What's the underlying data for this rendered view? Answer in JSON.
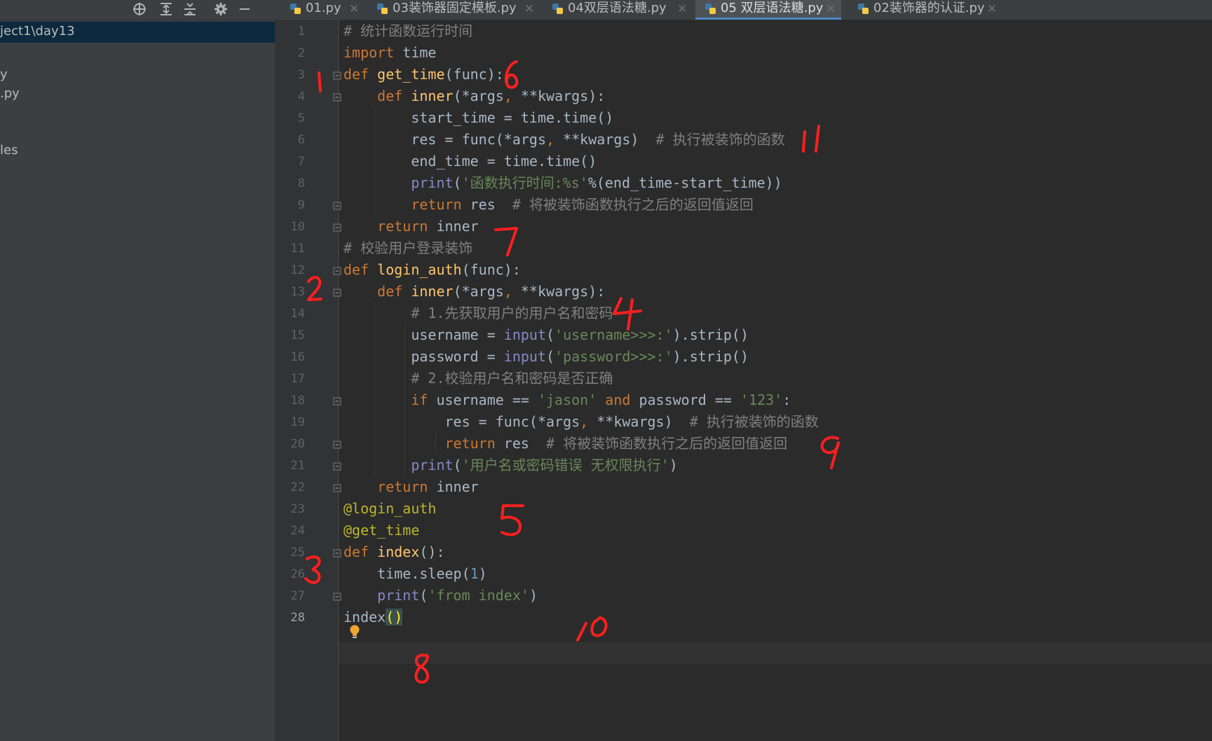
{
  "sidebar": {
    "path": "ject1\\day13",
    "items": [
      "y",
      ".py",
      "les"
    ]
  },
  "tabs": [
    {
      "label": "01.py",
      "active": false
    },
    {
      "label": "03装饰器固定模板.py",
      "active": false
    },
    {
      "label": "04双层语法糖.py",
      "active": false
    },
    {
      "label": "05 双层语法糖.py",
      "active": true
    },
    {
      "label": "02装饰器的认证.py",
      "active": false
    }
  ],
  "toolbar": {
    "icons": [
      "locate-icon",
      "expand-all-icon",
      "collapse-all-icon",
      "gear-icon",
      "minimize-icon"
    ]
  },
  "editor": {
    "current_line": 28,
    "lines": [
      {
        "n": "1",
        "tokens": [
          [
            "cmt",
            "# 统计函数运行时间"
          ]
        ]
      },
      {
        "n": "2",
        "tokens": [
          [
            "kw",
            "import"
          ],
          [
            "",
            " time"
          ]
        ]
      },
      {
        "n": "3",
        "tokens": [
          [
            "kw",
            "def "
          ],
          [
            "fn",
            "get_time"
          ],
          [
            "",
            "(func):"
          ]
        ]
      },
      {
        "n": "4",
        "tokens": [
          [
            "",
            "    "
          ],
          [
            "kw",
            "def "
          ],
          [
            "fn",
            "inner"
          ],
          [
            "",
            "(*args"
          ],
          [
            "kw",
            ", "
          ],
          [
            "",
            "**kwargs):"
          ]
        ]
      },
      {
        "n": "5",
        "tokens": [
          [
            "",
            "        start_time = time.time()"
          ]
        ]
      },
      {
        "n": "6",
        "tokens": [
          [
            "",
            "        res = func(*args"
          ],
          [
            "kw",
            ", "
          ],
          [
            "",
            "**kwargs)  "
          ],
          [
            "cmt",
            "# 执行被装饰的函数"
          ]
        ]
      },
      {
        "n": "7",
        "tokens": [
          [
            "",
            "        end_time = time.time()"
          ]
        ]
      },
      {
        "n": "8",
        "tokens": [
          [
            "",
            "        "
          ],
          [
            "bi",
            "print"
          ],
          [
            "",
            "("
          ],
          [
            "str",
            "'函数执行时间:%s'"
          ],
          [
            "",
            "%(end_time-start_time))"
          ]
        ]
      },
      {
        "n": "9",
        "tokens": [
          [
            "",
            "        "
          ],
          [
            "kw",
            "return"
          ],
          [
            "",
            " res  "
          ],
          [
            "cmt",
            "# 将被装饰函数执行之后的返回值返回"
          ]
        ]
      },
      {
        "n": "10",
        "tokens": [
          [
            "",
            "    "
          ],
          [
            "kw",
            "return"
          ],
          [
            "",
            " inner"
          ]
        ]
      },
      {
        "n": "11",
        "tokens": [
          [
            "cmt",
            "# 校验用户登录装饰"
          ]
        ]
      },
      {
        "n": "12",
        "tokens": [
          [
            "kw",
            "def "
          ],
          [
            "fn",
            "login_auth"
          ],
          [
            "",
            "(func):"
          ]
        ]
      },
      {
        "n": "13",
        "tokens": [
          [
            "",
            "    "
          ],
          [
            "kw",
            "def "
          ],
          [
            "fn",
            "inner"
          ],
          [
            "",
            "(*args"
          ],
          [
            "kw",
            ", "
          ],
          [
            "",
            "**kwargs):"
          ]
        ]
      },
      {
        "n": "14",
        "tokens": [
          [
            "",
            "        "
          ],
          [
            "cmt",
            "# 1.先获取用户的用户名和密码"
          ]
        ]
      },
      {
        "n": "15",
        "tokens": [
          [
            "",
            "        username = "
          ],
          [
            "bi",
            "input"
          ],
          [
            "",
            "("
          ],
          [
            "str",
            "'username>>>:'"
          ],
          [
            "",
            ").strip()"
          ]
        ]
      },
      {
        "n": "16",
        "tokens": [
          [
            "",
            "        password = "
          ],
          [
            "bi",
            "input"
          ],
          [
            "",
            "("
          ],
          [
            "str",
            "'password>>>:'"
          ],
          [
            "",
            ").strip()"
          ]
        ]
      },
      {
        "n": "17",
        "tokens": [
          [
            "",
            "        "
          ],
          [
            "cmt",
            "# 2.校验用户名和密码是否正确"
          ]
        ]
      },
      {
        "n": "18",
        "tokens": [
          [
            "",
            "        "
          ],
          [
            "kw",
            "if"
          ],
          [
            "",
            " username == "
          ],
          [
            "str",
            "'jason'"
          ],
          [
            "kw",
            " and"
          ],
          [
            "",
            " password == "
          ],
          [
            "str",
            "'123'"
          ],
          [
            "",
            ":"
          ]
        ]
      },
      {
        "n": "19",
        "tokens": [
          [
            "",
            "            res = func(*args"
          ],
          [
            "kw",
            ", "
          ],
          [
            "",
            "**kwargs)  "
          ],
          [
            "cmt",
            "# 执行被装饰的函数"
          ]
        ]
      },
      {
        "n": "20",
        "tokens": [
          [
            "",
            "            "
          ],
          [
            "kw",
            "return"
          ],
          [
            "",
            " res  "
          ],
          [
            "cmt",
            "# 将被装饰函数执行之后的返回值返回"
          ]
        ]
      },
      {
        "n": "21",
        "tokens": [
          [
            "",
            "        "
          ],
          [
            "bi",
            "print"
          ],
          [
            "",
            "("
          ],
          [
            "str",
            "'用户名或密码错误 无权限执行'"
          ],
          [
            "",
            ")"
          ]
        ]
      },
      {
        "n": "22",
        "tokens": [
          [
            "",
            "    "
          ],
          [
            "kw",
            "return"
          ],
          [
            "",
            " inner"
          ]
        ]
      },
      {
        "n": "23",
        "tokens": [
          [
            "dec",
            "@login_auth"
          ]
        ]
      },
      {
        "n": "24",
        "tokens": [
          [
            "dec",
            "@get_time"
          ]
        ]
      },
      {
        "n": "25",
        "tokens": [
          [
            "kw",
            "def "
          ],
          [
            "fn",
            "index"
          ],
          [
            "",
            "():"
          ]
        ]
      },
      {
        "n": "26",
        "tokens": [
          [
            "",
            "    time.sleep("
          ],
          [
            "num",
            "1"
          ],
          [
            "",
            ")"
          ]
        ]
      },
      {
        "n": "27",
        "tokens": [
          [
            "",
            "    "
          ],
          [
            "bi",
            "print"
          ],
          [
            "",
            "("
          ],
          [
            "str",
            "'from index'"
          ],
          [
            "",
            ")"
          ]
        ]
      },
      {
        "n": "28",
        "tokens": [
          [
            "",
            "index"
          ],
          [
            "match",
            "()"
          ]
        ]
      }
    ]
  },
  "annotations": [
    {
      "label": "1",
      "line": "3"
    },
    {
      "label": "2",
      "line": "12"
    },
    {
      "label": "3",
      "line": "24"
    },
    {
      "label": "4",
      "line": "13"
    },
    {
      "label": "5",
      "line": "22"
    },
    {
      "label": "6",
      "line": "3"
    },
    {
      "label": "7",
      "line": "10"
    },
    {
      "label": "8",
      "line": "28"
    },
    {
      "label": "9",
      "line": "19"
    },
    {
      "label": "10",
      "line": "27"
    },
    {
      "label": "11",
      "line": "6"
    }
  ],
  "colors": {
    "keyword": "#cc7832",
    "function": "#ffc66d",
    "string": "#6a8759",
    "comment": "#808080",
    "decorator": "#bbb529",
    "number": "#6897bb",
    "builtin": "#8888c6",
    "annotation": "#ff1f1f",
    "tab_underline": "#4a88c7"
  }
}
